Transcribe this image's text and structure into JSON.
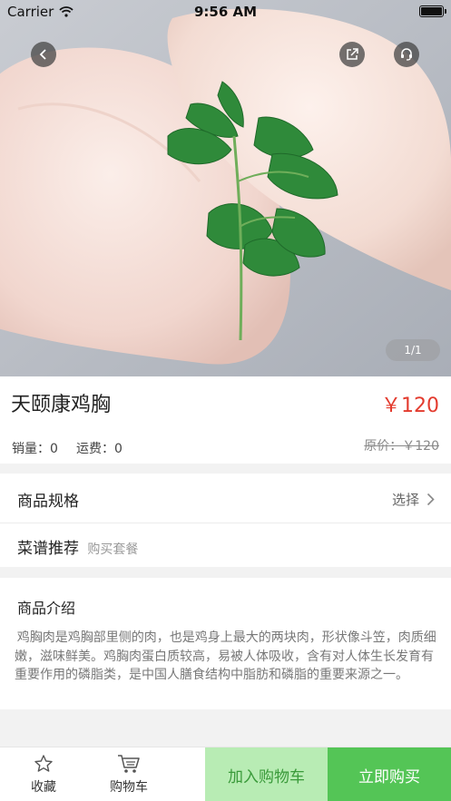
{
  "status_bar": {
    "carrier": "Carrier",
    "time": "9:56 AM"
  },
  "hero": {
    "page_indicator": "1/1"
  },
  "product": {
    "name": "天颐康鸡胸",
    "price": "￥120",
    "sales_label": "销量：",
    "sales_value": "0",
    "shipping_label": "运费：",
    "shipping_value": "0",
    "original_price": "原价：￥120"
  },
  "spec": {
    "title": "商品规格",
    "action": "选择"
  },
  "recipe": {
    "title": "菜谱推荐",
    "subtitle": "购买套餐"
  },
  "intro": {
    "title": "商品介绍",
    "text": "鸡胸肉是鸡胸部里侧的肉，也是鸡身上最大的两块肉，形状像斗笠，肉质细嫩，滋味鲜美。鸡胸肉蛋白质较高，易被人体吸收，含有对人体生长发育有重要作用的磷脂类，是中国人膳食结构中脂肪和磷脂的重要来源之一。"
  },
  "bottom_bar": {
    "favorite": "收藏",
    "cart": "购物车",
    "add_to_cart": "加入购物车",
    "buy_now": "立即购买"
  },
  "colors": {
    "price_red": "#e33b2e",
    "cart_button_bg": "#b8ecb4",
    "buy_button_bg": "#54c556"
  },
  "icons": [
    "back-icon",
    "share-icon",
    "customer-service-icon",
    "chevron-right-icon",
    "star-icon",
    "shopping-cart-icon",
    "wifi-icon",
    "battery-icon"
  ]
}
